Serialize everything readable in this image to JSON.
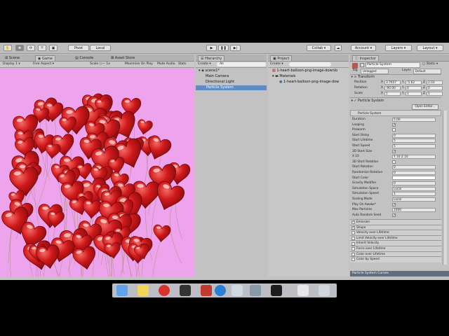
{
  "toolbar": {
    "pivot": "Pivot",
    "local": "Local",
    "collab": "Collab ▾",
    "account": "Account ▾",
    "layers": "Layers ▾",
    "layout": "Layout ▾"
  },
  "tabs": {
    "scene": "Scene",
    "game": "Game",
    "console": "Console",
    "asset_store": "Asset Store"
  },
  "game_bar": {
    "display": "Display 1",
    "aspect": "Free Aspect",
    "scale_label": "Scale",
    "scale_value": "1x",
    "maximize": "Maximize On Play",
    "mute": "Mute Audio",
    "stats": "Stats",
    "gizmos": "Gizmos"
  },
  "game_view": {
    "background": "#eda4ec"
  },
  "hierarchy": {
    "tab": "Hierarchy",
    "create": "Create ▾",
    "search_placeholder": "All",
    "scene": "scene1*",
    "items": [
      "Main Camera",
      "Directional Light",
      "Particle System"
    ]
  },
  "project": {
    "tab": "Project",
    "create": "Create ▾",
    "items": [
      "1-heart-balloon-png-image-downlo",
      "Materials",
      "1-heart-balloon-png-image-dow"
    ]
  },
  "inspector": {
    "tab": "Inspector",
    "object_name": "Particle System",
    "static_label": "Static",
    "tag_label": "Tag",
    "tag_value": "Untagged",
    "layer_label": "Layer",
    "layer_value": "Default",
    "transform": {
      "title": "Transform",
      "position_label": "Position",
      "rotation_label": "Rotation",
      "scale_label": "Scale",
      "pos": [
        "3.7657",
        "-5.62",
        "2.03"
      ],
      "rot": [
        "-90.00",
        "0",
        "0"
      ],
      "scl": [
        "1",
        "1",
        "1"
      ]
    },
    "ps_header": "Particle System",
    "open_editor": "Open Editor...",
    "ps_sub": "Particle System",
    "rows": [
      {
        "label": "Duration",
        "value": "5.00"
      },
      {
        "label": "Looping",
        "value": "✓",
        "check": true
      },
      {
        "label": "Prewarm",
        "value": "",
        "check": true
      },
      {
        "label": "Start Delay",
        "value": "0"
      },
      {
        "label": "Start Lifetime",
        "value": "5"
      },
      {
        "label": "Start Speed",
        "value": "5"
      },
      {
        "label": "3D Start Size",
        "value": "✓",
        "check": true
      },
      {
        "label": "X 10",
        "value": "Y 10      Z 10"
      },
      {
        "label": "3D Start Rotation",
        "value": "",
        "check": true
      },
      {
        "label": "Start Rotation",
        "value": "0"
      },
      {
        "label": "Randomize Rotation",
        "value": "0"
      },
      {
        "label": "Start Color",
        "value": ""
      },
      {
        "label": "Gravity Modifier",
        "value": "0"
      },
      {
        "label": "Simulation Space",
        "value": "Local"
      },
      {
        "label": "Simulation Speed",
        "value": "1"
      },
      {
        "label": "Scaling Mode",
        "value": "Local"
      },
      {
        "label": "Play On Awake*",
        "value": "✓",
        "check": true
      },
      {
        "label": "Max Particles",
        "value": "1000"
      },
      {
        "label": "Auto Random Seed",
        "value": "✓",
        "check": true
      }
    ],
    "modules": [
      {
        "label": "Emission",
        "on": true
      },
      {
        "label": "Shape",
        "on": true
      },
      {
        "label": "Velocity over Lifetime",
        "on": false
      },
      {
        "label": "Limit Velocity over Lifetime",
        "on": false
      },
      {
        "label": "Inherit Velocity",
        "on": false
      },
      {
        "label": "Force over Lifetime",
        "on": false
      },
      {
        "label": "Color over Lifetime",
        "on": false
      },
      {
        "label": "Color by Speed",
        "on": false
      }
    ],
    "curves": "Particle System Curves"
  }
}
